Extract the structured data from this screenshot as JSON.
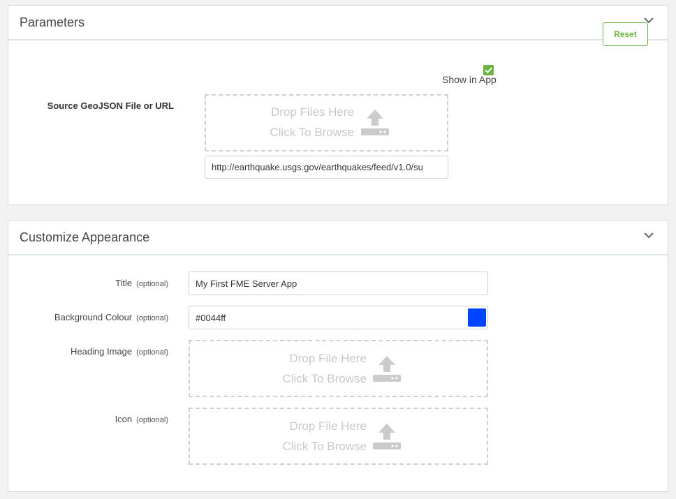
{
  "parameters": {
    "title": "Parameters",
    "reset_label": "Reset",
    "show_in_app_label": "Show in App",
    "show_in_app_checked": true,
    "source_label": "Source GeoJSON File or URL",
    "drop_line1": "Drop Files Here",
    "drop_line2": "Click To Browse",
    "source_url": "http://earthquake.usgs.gov/earthquakes/feed/v1.0/su"
  },
  "appearance": {
    "title": "Customize Appearance",
    "optional_text": "(optional)",
    "title_field": {
      "label": "Title",
      "value": "My First FME Server App"
    },
    "background_colour": {
      "label": "Background Colour",
      "value": "#0044ff"
    },
    "heading_image": {
      "label": "Heading Image",
      "drop_line1": "Drop File Here",
      "drop_line2": "Click To Browse"
    },
    "icon": {
      "label": "Icon",
      "drop_line1": "Drop File Here",
      "drop_line2": "Click To Browse"
    }
  },
  "colors": {
    "accent_green": "#6cb33f",
    "swatch": "#0044ff"
  },
  "icons": {
    "chevron": "chevron-down-icon",
    "upload": "upload-icon",
    "check": "checkmark-icon"
  }
}
